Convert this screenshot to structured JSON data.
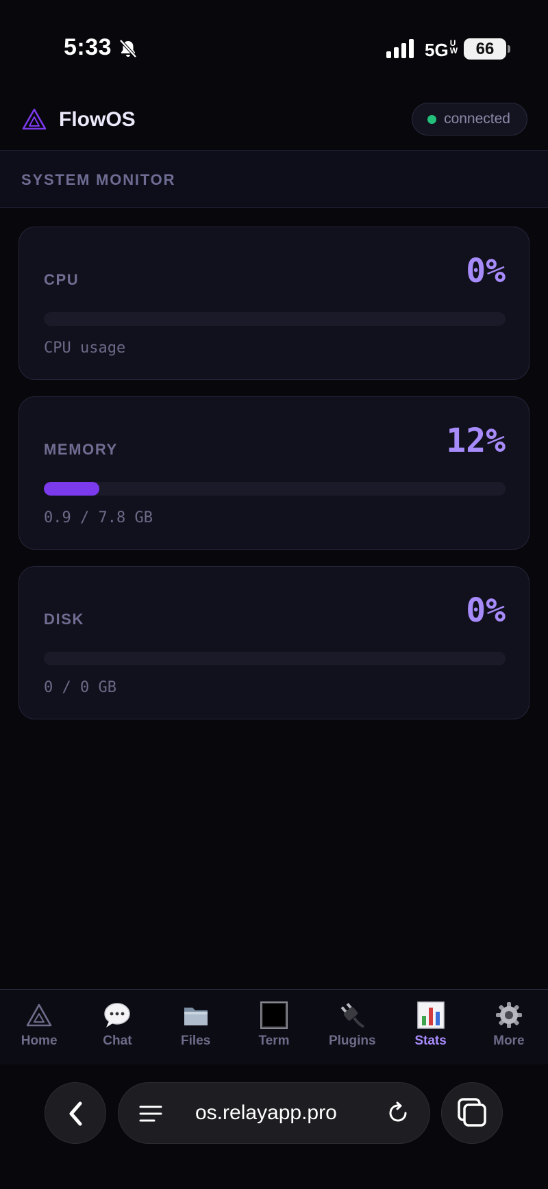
{
  "status_bar": {
    "time": "5:33",
    "network": "5G",
    "network_sup": "UW",
    "battery": "66"
  },
  "header": {
    "app_name": "FlowOS",
    "connection_status": "connected",
    "connection_color": "#22c07a"
  },
  "section": {
    "title": "SYSTEM MONITOR"
  },
  "metrics": [
    {
      "label": "CPU",
      "value": "0%",
      "percent": 0,
      "detail": "CPU usage"
    },
    {
      "label": "MEMORY",
      "value": "12%",
      "percent": 12,
      "detail": "0.9 / 7.8 GB"
    },
    {
      "label": "DISK",
      "value": "0%",
      "percent": 0,
      "detail": "0 / 0 GB"
    }
  ],
  "tabs": [
    {
      "label": "Home",
      "icon": "home-triangle-icon",
      "active": false
    },
    {
      "label": "Chat",
      "icon": "speech-bubble-icon",
      "active": false
    },
    {
      "label": "Files",
      "icon": "folder-icon",
      "active": false
    },
    {
      "label": "Term",
      "icon": "terminal-icon",
      "active": false
    },
    {
      "label": "Plugins",
      "icon": "plug-icon",
      "active": false
    },
    {
      "label": "Stats",
      "icon": "bar-chart-icon",
      "active": true
    },
    {
      "label": "More",
      "icon": "gear-icon",
      "active": false
    }
  ],
  "browser": {
    "url": "os.relayapp.pro"
  },
  "colors": {
    "accent": "#a78bfa",
    "bar_fill": "#7c3aed",
    "background": "#07070c"
  }
}
